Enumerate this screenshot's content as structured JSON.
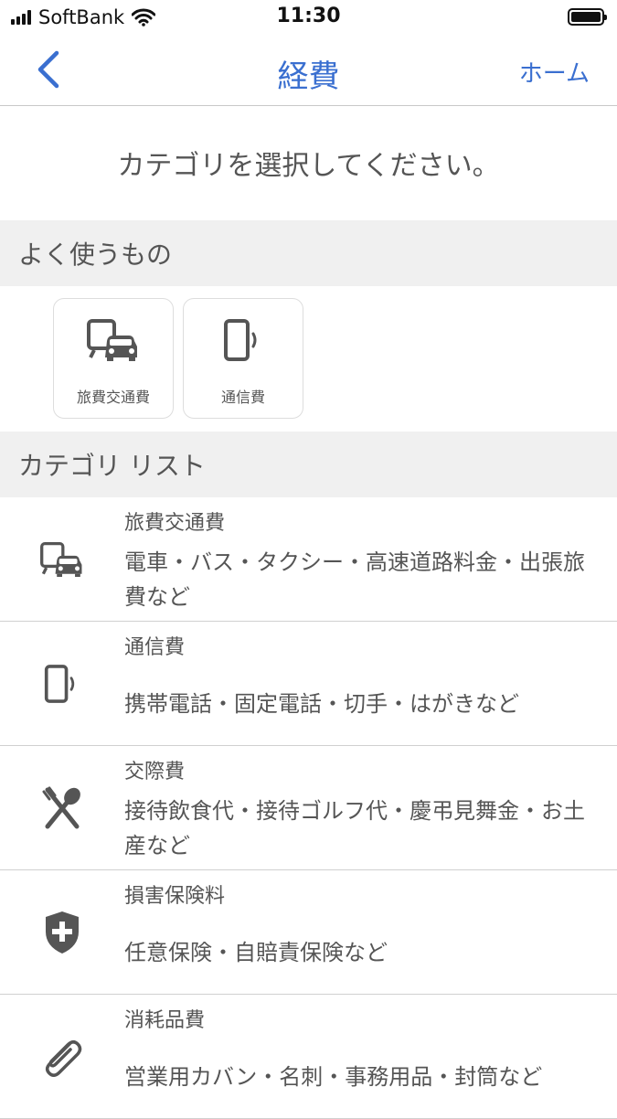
{
  "status_bar": {
    "carrier": "SoftBank",
    "time": "11:30"
  },
  "nav": {
    "title": "経費",
    "home_label": "ホーム"
  },
  "prompt": "カテゴリを選択してください。",
  "favorites": {
    "header": "よく使うもの",
    "items": [
      {
        "label": "旅費交通費",
        "icon": "car-train-icon"
      },
      {
        "label": "通信費",
        "icon": "smartphone-icon"
      }
    ]
  },
  "categories": {
    "header": "カテゴリ リスト",
    "items": [
      {
        "name": "旅費交通費",
        "description": "電車・バス・タクシー・高速道路料金・出張旅費など",
        "icon": "car-train-icon"
      },
      {
        "name": "通信費",
        "description": "携帯電話・固定電話・切手・はがきなど",
        "icon": "smartphone-icon"
      },
      {
        "name": "交際費",
        "description": "接待飲食代・接待ゴルフ代・慶弔見舞金・お土産など",
        "icon": "fork-spoon-icon"
      },
      {
        "name": "損害保険料",
        "description": "任意保険・自賠責保険など",
        "icon": "shield-plus-icon"
      },
      {
        "name": "消耗品費",
        "description": "営業用カバン・名刺・事務用品・封筒など",
        "icon": "paperclip-icon"
      }
    ]
  },
  "colors": {
    "accent": "#3a6fd0",
    "text": "#555555",
    "section_bg": "#f0f0f0",
    "icon": "#555555"
  }
}
